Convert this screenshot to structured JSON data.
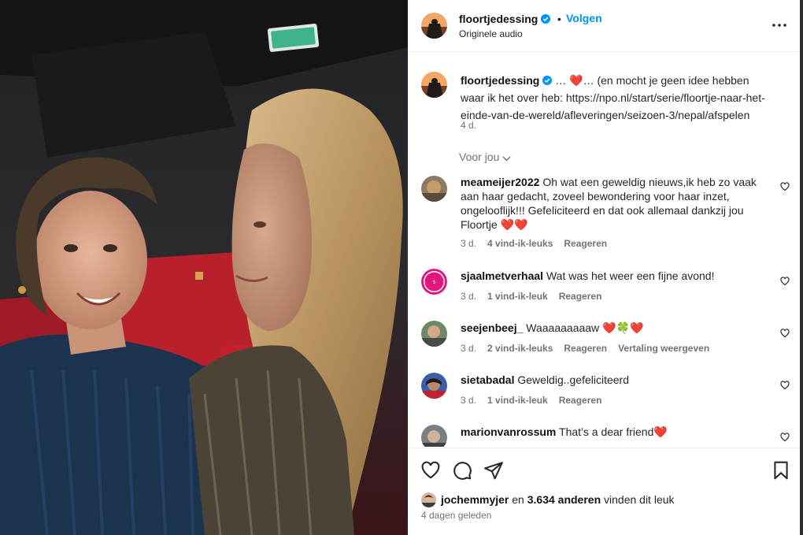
{
  "header": {
    "username": "floortjedessing",
    "separator": "•",
    "follow_label": "Volgen",
    "audio_label": "Originele audio"
  },
  "caption": {
    "username": "floortjedessing",
    "text_before": " … ",
    "text_after": "… (en mocht je geen idee hebben waar ik het over heb: https://npo.nl/start/serie/floortje-naar-het-einde-van-de-wereld/afleveringen/seizoen-3/nepal/afspelen",
    "time": "4 d."
  },
  "sort_label": "Voor jou",
  "comments": [
    {
      "username": "meameijer2022",
      "text": "Oh wat een geweldig nieuws,ik heb zo vaak aan haar gedacht, zoveel bewondering voor haar inzet, ongelooflijk!!! Gefeliciteerd en dat ook allemaal dankzij jou Floortje ",
      "emoji": "❤️❤️",
      "time": "3 d.",
      "likes": "4 vind-ik-leuks",
      "reply": "Reageren"
    },
    {
      "username": "sjaalmetverhaal",
      "text": "Wat was het weer een fijne avond!",
      "time": "3 d.",
      "likes": "1 vind-ik-leuk",
      "reply": "Reageren"
    },
    {
      "username": "seejenbeej_",
      "text": "Waaaaaaaaaw ",
      "emoji_a": "❤️",
      "emoji_b": "🍀",
      "emoji_c": "❤️",
      "time": "3 d.",
      "likes": "2 vind-ik-leuks",
      "reply": "Reageren",
      "translate": "Vertaling weergeven"
    },
    {
      "username": "sietabadal",
      "text": "Geweldig..gefeliciteerd",
      "time": "3 d.",
      "likes": "1 vind-ik-leuk",
      "reply": "Reageren"
    },
    {
      "username": "marionvanrossum",
      "text": "That’s a dear friend",
      "emoji": "❤️"
    }
  ],
  "likes": {
    "user": "jochemmyjer",
    "mid": " en ",
    "count": "3.634 anderen",
    "suffix": " vinden dit leuk"
  },
  "posted": "4 dagen geleden",
  "colors": {
    "accent": "#0095f6",
    "muted": "#737373",
    "heart": "#ed2643"
  }
}
